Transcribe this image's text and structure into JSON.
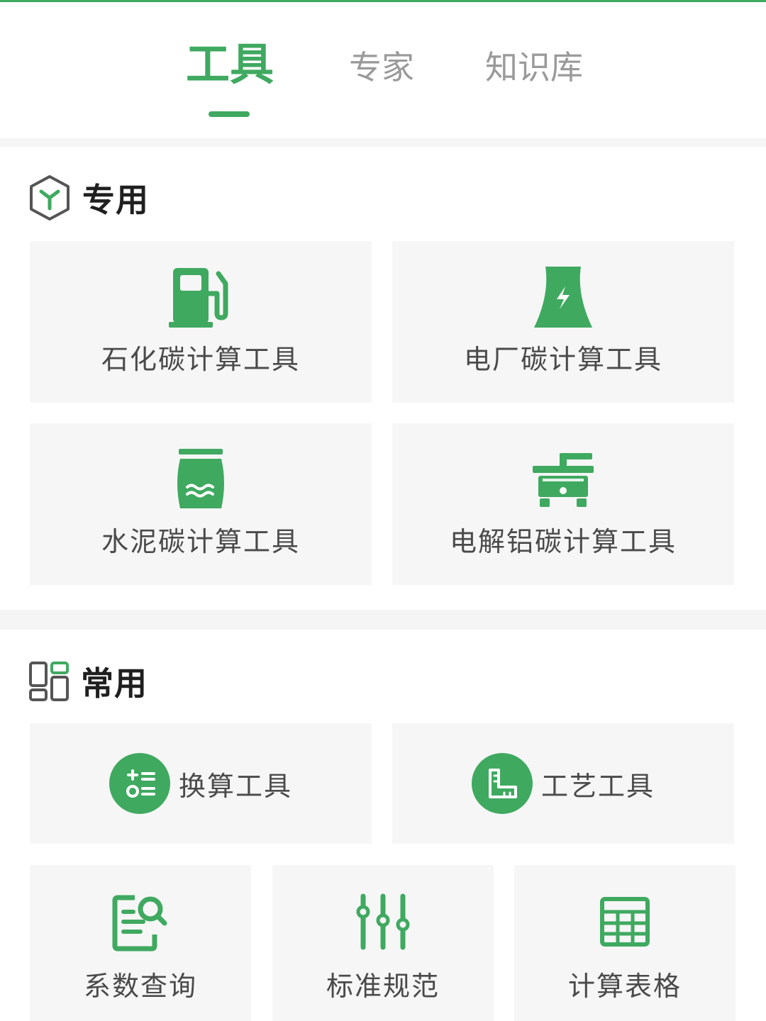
{
  "tabs": [
    {
      "label": "工具",
      "active": true
    },
    {
      "label": "专家",
      "active": false
    },
    {
      "label": "知识库",
      "active": false
    }
  ],
  "sections": {
    "special": {
      "title": "专用",
      "icon": "cube-icon",
      "items": [
        {
          "label": "石化碳计算工具",
          "icon": "fuel-pump-icon"
        },
        {
          "label": "电厂碳计算工具",
          "icon": "power-plant-icon"
        },
        {
          "label": "水泥碳计算工具",
          "icon": "cement-bag-icon"
        },
        {
          "label": "电解铝碳计算工具",
          "icon": "electrolysis-machine-icon"
        }
      ]
    },
    "common": {
      "title": "常用",
      "icon": "grid-icon",
      "row_items": [
        {
          "label": "换算工具",
          "icon": "calculator-icon"
        },
        {
          "label": "工艺工具",
          "icon": "ruler-icon"
        }
      ],
      "items": [
        {
          "label": "系数查询",
          "icon": "document-search-icon"
        },
        {
          "label": "标准规范",
          "icon": "sliders-icon"
        },
        {
          "label": "计算表格",
          "icon": "table-icon"
        }
      ]
    }
  },
  "colors": {
    "accent": "#3fa960",
    "background": "#ffffff",
    "card": "#f6f6f6",
    "inactive_tab": "#9a9a9a"
  }
}
